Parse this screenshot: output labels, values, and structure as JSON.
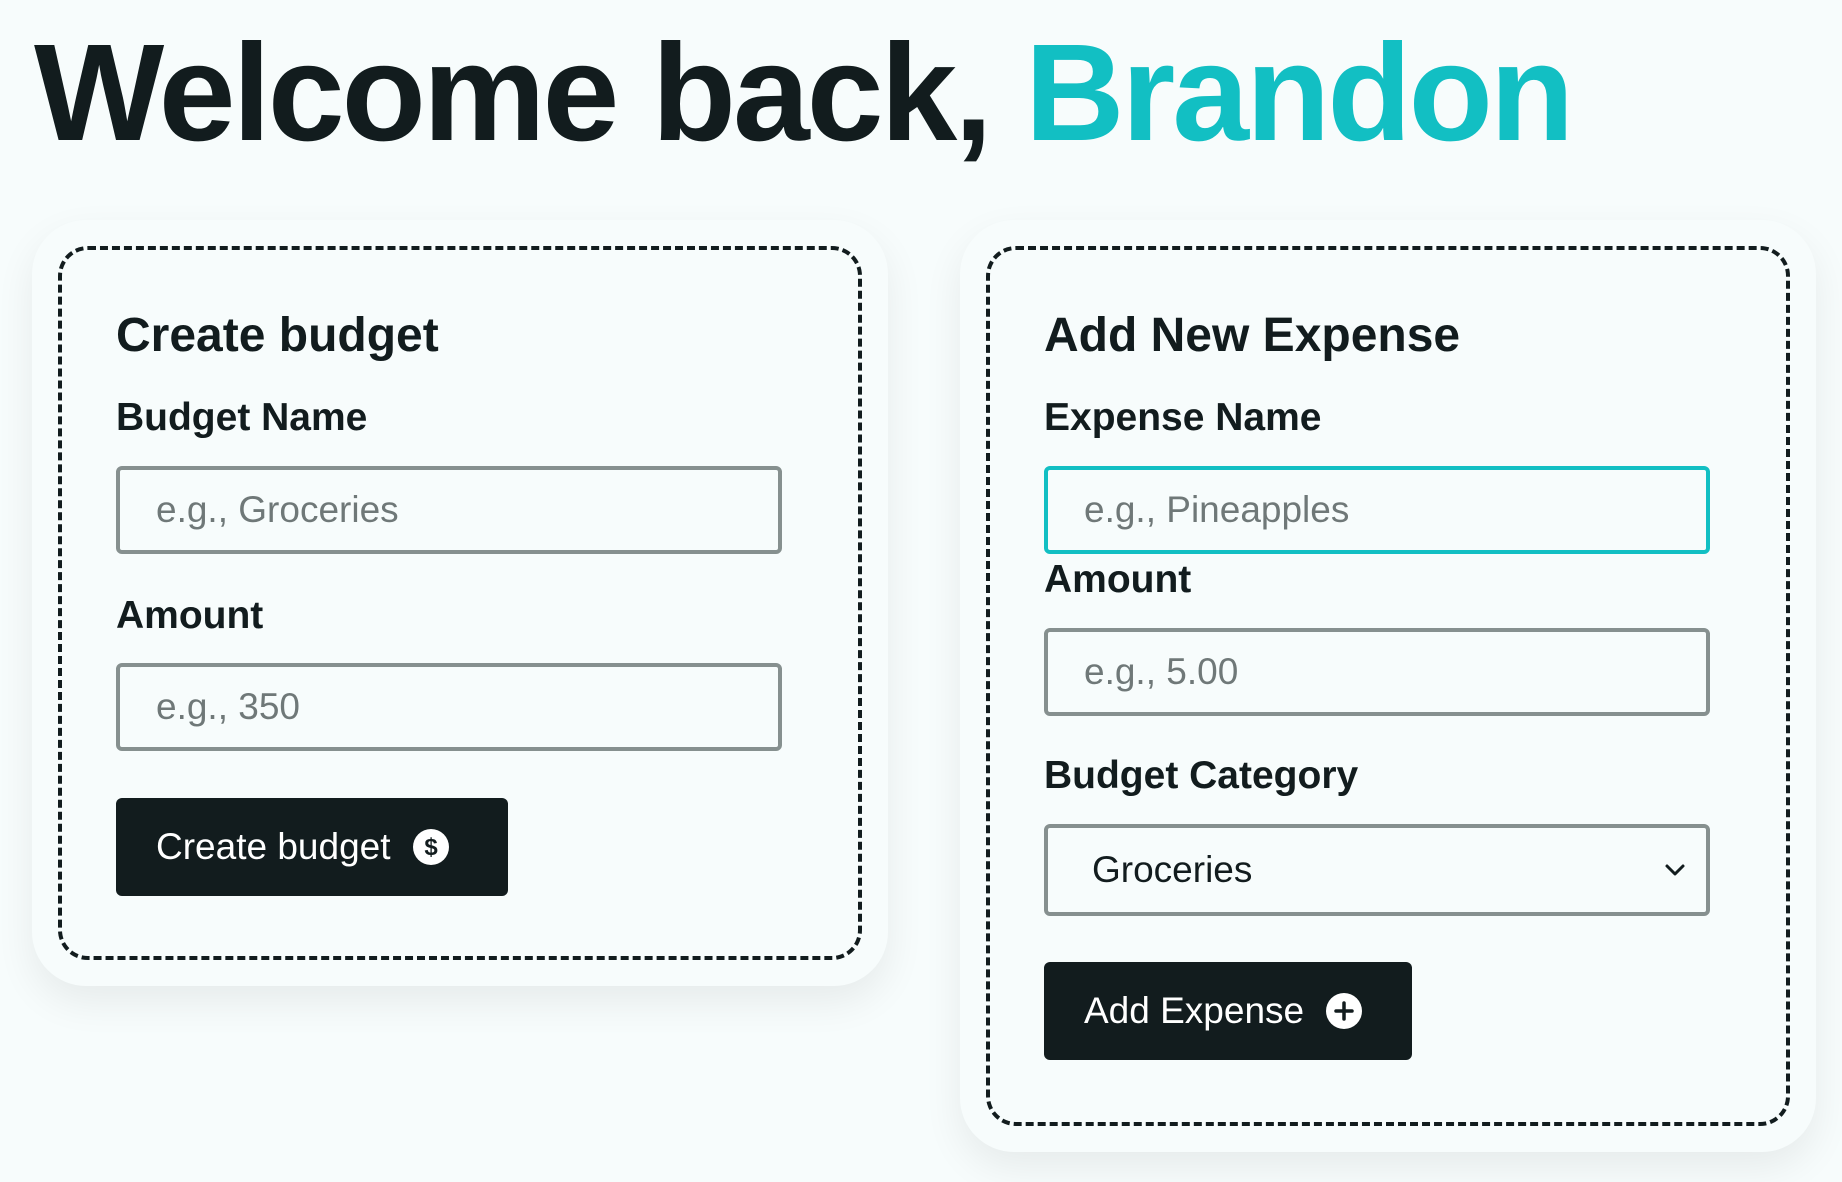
{
  "greeting": {
    "prefix": "Welcome back, ",
    "name": "Brandon"
  },
  "create_budget": {
    "title": "Create budget",
    "name_label": "Budget Name",
    "name_placeholder": "e.g., Groceries",
    "amount_label": "Amount",
    "amount_placeholder": "e.g., 350",
    "button_label": "Create budget",
    "button_icon": "dollar-circle-icon"
  },
  "add_expense": {
    "title": "Add New Expense",
    "name_label": "Expense Name",
    "name_placeholder": "e.g., Pineapples",
    "amount_label": "Amount",
    "amount_placeholder": "e.g., 5.00",
    "category_label": "Budget Category",
    "category_selected": "Groceries",
    "category_icon": "chevron-down-icon",
    "button_label": "Add Expense",
    "button_icon": "plus-circle-icon"
  },
  "colors": {
    "accent": "#12bfc3",
    "text": "#121c1e",
    "background": "#f7fcfc",
    "input_border": "#86908f",
    "button_bg": "#121c1e"
  }
}
